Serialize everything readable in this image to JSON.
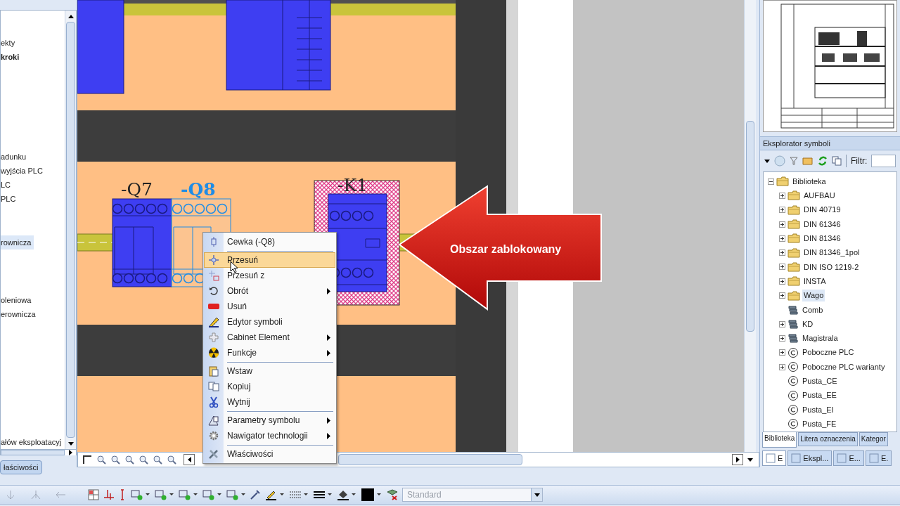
{
  "left_panel": {
    "groups": [
      [
        {
          "label": "ekty",
          "bold": false,
          "selected": false
        },
        {
          "label": "kroki",
          "bold": true,
          "selected": false
        }
      ],
      [
        {
          "label": "adunku",
          "bold": false,
          "selected": false
        },
        {
          "label": "wyjścia PLC",
          "bold": false,
          "selected": false
        },
        {
          "label": "LC",
          "bold": false,
          "selected": false
        },
        {
          "label": "PLC",
          "bold": false,
          "selected": false
        }
      ],
      [
        {
          "label": "rownicza",
          "bold": false,
          "selected": true
        }
      ],
      [
        {
          "label": "oleniowa",
          "bold": false,
          "selected": false
        },
        {
          "label": "erownicza",
          "bold": false,
          "selected": false
        }
      ],
      [
        {
          "label": "ałów eksploatacyj",
          "bold": false,
          "selected": false
        }
      ]
    ],
    "tab": "łaściwości"
  },
  "canvas": {
    "labels": [
      {
        "text": "-Q7",
        "highlighted": false
      },
      {
        "text": "-Q8",
        "highlighted": true
      },
      {
        "text": "-K1",
        "highlighted": false
      }
    ],
    "callout": "Obszar zablokowany"
  },
  "context_menu": [
    {
      "kind": "header",
      "label": "Cewka (-Q8)"
    },
    {
      "kind": "separator"
    },
    {
      "kind": "item",
      "label": "Przesuń",
      "selected": true,
      "submenu": false
    },
    {
      "kind": "item",
      "label": "Przesuń z",
      "selected": false,
      "submenu": false
    },
    {
      "kind": "item",
      "label": "Obrót",
      "selected": false,
      "submenu": true
    },
    {
      "kind": "item",
      "label": "Usuń",
      "selected": false,
      "submenu": false
    },
    {
      "kind": "item",
      "label": "Edytor symboli",
      "selected": false,
      "submenu": false
    },
    {
      "kind": "item",
      "label": "Cabinet Element",
      "selected": false,
      "submenu": true
    },
    {
      "kind": "item",
      "label": "Funkcje",
      "selected": false,
      "submenu": true
    },
    {
      "kind": "separator"
    },
    {
      "kind": "item",
      "label": "Wstaw",
      "selected": false,
      "submenu": false
    },
    {
      "kind": "item",
      "label": "Kopiuj",
      "selected": false,
      "submenu": false
    },
    {
      "kind": "item",
      "label": "Wytnij",
      "selected": false,
      "submenu": false
    },
    {
      "kind": "separator"
    },
    {
      "kind": "item",
      "label": "Parametry symbolu",
      "selected": false,
      "submenu": true
    },
    {
      "kind": "item",
      "label": "Nawigator technologii",
      "selected": false,
      "submenu": true
    },
    {
      "kind": "separator"
    },
    {
      "kind": "item",
      "label": "Właściwości",
      "selected": false,
      "submenu": false
    }
  ],
  "symbol_explorer": {
    "title": "Eksplorator symboli",
    "filter_label": "Filtr:",
    "tree": {
      "label": "Biblioteka",
      "kind": "folder",
      "expanded": true,
      "selected": false,
      "children": [
        {
          "label": "AUFBAU",
          "kind": "folder",
          "expandable": true,
          "selected": false
        },
        {
          "label": "DIN 40719",
          "kind": "folder",
          "expandable": true,
          "selected": false
        },
        {
          "label": "DIN 61346",
          "kind": "folder",
          "expandable": true,
          "selected": false
        },
        {
          "label": "DIN 81346",
          "kind": "folder",
          "expandable": true,
          "selected": false
        },
        {
          "label": "DIN 81346_1pol",
          "kind": "folder",
          "expandable": true,
          "selected": false
        },
        {
          "label": "DIN ISO 1219-2",
          "kind": "folder",
          "expandable": true,
          "selected": false
        },
        {
          "label": "INSTA",
          "kind": "folder",
          "expandable": true,
          "selected": false
        },
        {
          "label": "Wago",
          "kind": "folder",
          "expandable": true,
          "selected": true
        },
        {
          "label": "Comb",
          "kind": "stack",
          "expandable": false,
          "selected": false
        },
        {
          "label": "KD",
          "kind": "stack",
          "expandable": true,
          "selected": false
        },
        {
          "label": "Magistrala",
          "kind": "stack",
          "expandable": true,
          "selected": false
        },
        {
          "label": "Poboczne PLC",
          "kind": "copyright",
          "expandable": true,
          "selected": false
        },
        {
          "label": "Poboczne PLC warianty",
          "kind": "copyright",
          "expandable": true,
          "selected": false
        },
        {
          "label": "Pusta_CE",
          "kind": "copyright",
          "expandable": false,
          "selected": false
        },
        {
          "label": "Pusta_EE",
          "kind": "copyright",
          "expandable": false,
          "selected": false
        },
        {
          "label": "Pusta_EI",
          "kind": "copyright",
          "expandable": false,
          "selected": false
        },
        {
          "label": "Pusta_FE",
          "kind": "copyright",
          "expandable": false,
          "selected": false
        }
      ]
    },
    "tabs": [
      {
        "label": "Biblioteka",
        "selected": true
      },
      {
        "label": "Litera oznaczenia",
        "selected": false
      },
      {
        "label": "Kategor",
        "selected": false
      }
    ],
    "bottom_tabs": [
      {
        "label": "E",
        "selected": true
      },
      {
        "label": "Ekspl...",
        "selected": false
      },
      {
        "label": "E...",
        "selected": false
      },
      {
        "label": "E.",
        "selected": false
      }
    ]
  },
  "toolbar": {
    "style_combo": {
      "placeholder": "Standard"
    }
  }
}
